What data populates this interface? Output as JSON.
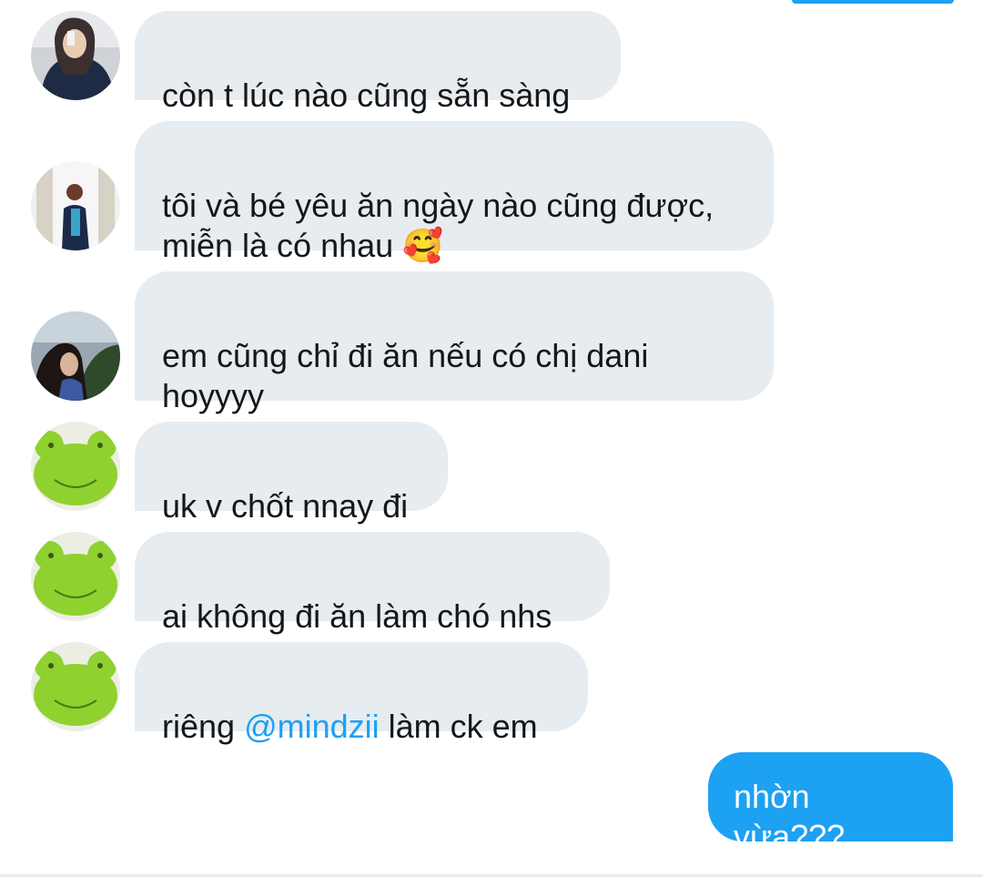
{
  "messages": [
    {
      "sender_avatar": "girl-dark-jacket-avatar",
      "text": "còn t lúc nào cũng sẵn sàng"
    },
    {
      "sender_avatar": "girl-mirror-selfie-avatar",
      "text": "tôi và bé yêu ăn ngày nào cũng được,\nmiễn là có nhau 🥰"
    },
    {
      "sender_avatar": "girl-outdoor-avatar",
      "text": "em cũng chỉ đi ăn nếu có chị dani\nhoyyyy"
    },
    {
      "sender_avatar": "green-frog-plush-avatar",
      "text": "uk v chốt nnay đi"
    },
    {
      "sender_avatar": "green-frog-plush-avatar",
      "text": "ai không đi ăn làm chó nhs"
    },
    {
      "sender_avatar": "green-frog-plush-avatar",
      "text_before": "riêng ",
      "mention": "@mindzii",
      "text_after": " làm ck em"
    }
  ],
  "outgoing": {
    "text": "nhờn vừa???"
  },
  "colors": {
    "bubble_in": "#e6ecf0",
    "bubble_out": "#1da1f2",
    "mention": "#1da1f2",
    "text": "#14171a"
  }
}
